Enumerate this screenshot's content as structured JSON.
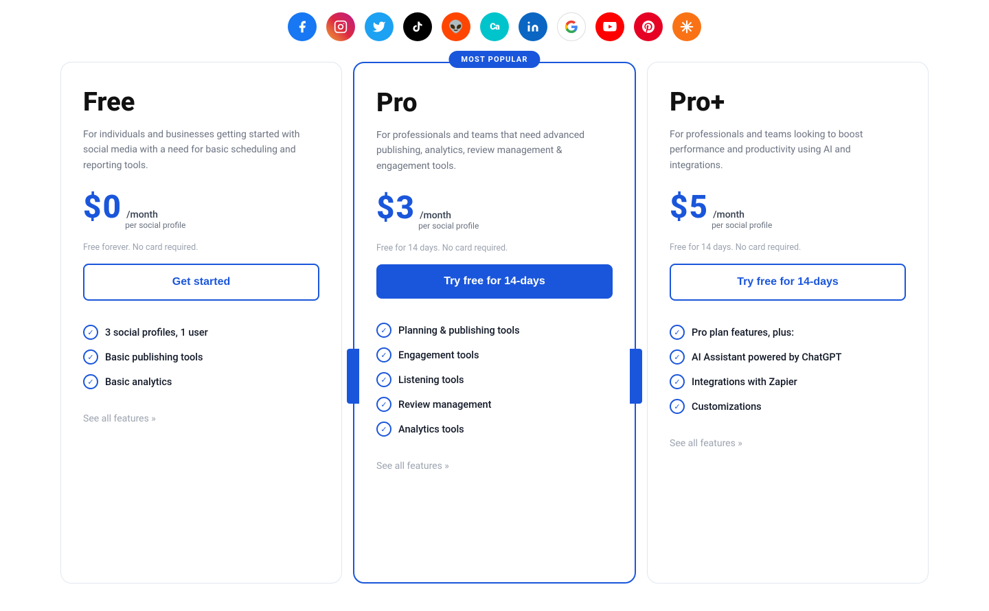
{
  "social_icons": [
    {
      "name": "facebook-icon",
      "label": "f",
      "class": "si-facebook"
    },
    {
      "name": "instagram-icon",
      "label": "📷",
      "class": "si-instagram"
    },
    {
      "name": "twitter-icon",
      "label": "🐦",
      "class": "si-twitter"
    },
    {
      "name": "tiktok-icon",
      "label": "♪",
      "class": "si-tiktok"
    },
    {
      "name": "reddit-icon",
      "label": "👽",
      "class": "si-reddit"
    },
    {
      "name": "canva-icon",
      "label": "Ca",
      "class": "si-canva"
    },
    {
      "name": "linkedin-icon",
      "label": "in",
      "class": "si-linkedin"
    },
    {
      "name": "google-icon",
      "label": "G",
      "class": "si-google"
    },
    {
      "name": "youtube-icon",
      "label": "▶",
      "class": "si-youtube"
    },
    {
      "name": "pinterest-icon",
      "label": "P",
      "class": "si-pinterest"
    },
    {
      "name": "asterisk-icon",
      "label": "✳",
      "class": "si-asterisk"
    }
  ],
  "plans": [
    {
      "id": "free",
      "name": "Free",
      "description": "For individuals and businesses getting started with social media with a need for basic scheduling and reporting tools.",
      "price": "0",
      "period": "/month",
      "subtext": "per social profile",
      "note": "Free forever. No card required.",
      "cta_label": "Get started",
      "cta_type": "outline",
      "features": [
        "3 social profiles, 1 user",
        "Basic publishing tools",
        "Basic analytics"
      ],
      "see_all_label": "See all features »",
      "popular": false
    },
    {
      "id": "pro",
      "name": "Pro",
      "description": "For professionals and teams that need advanced publishing, analytics, review management & engagement tools.",
      "price": "3",
      "period": "/month",
      "subtext": "per social profile",
      "note": "Free for 14 days. No card required.",
      "cta_label": "Try free for 14-days",
      "cta_type": "filled",
      "badge": "MOST POPULAR",
      "features": [
        "Planning & publishing tools",
        "Engagement tools",
        "Listening tools",
        "Review management",
        "Analytics tools"
      ],
      "see_all_label": "See all features »",
      "popular": true
    },
    {
      "id": "proplus",
      "name": "Pro+",
      "description": "For professionals and teams looking to boost performance and productivity using AI and integrations.",
      "price": "5",
      "period": "/month",
      "subtext": "per social profile",
      "note": "Free for 14 days. No card required.",
      "cta_label": "Try free for 14-days",
      "cta_type": "outline-blue",
      "features": [
        "Pro plan features, plus:",
        "AI Assistant powered by ChatGPT",
        "Integrations with Zapier",
        "Customizations"
      ],
      "see_all_label": "See all features »",
      "popular": false
    }
  ]
}
